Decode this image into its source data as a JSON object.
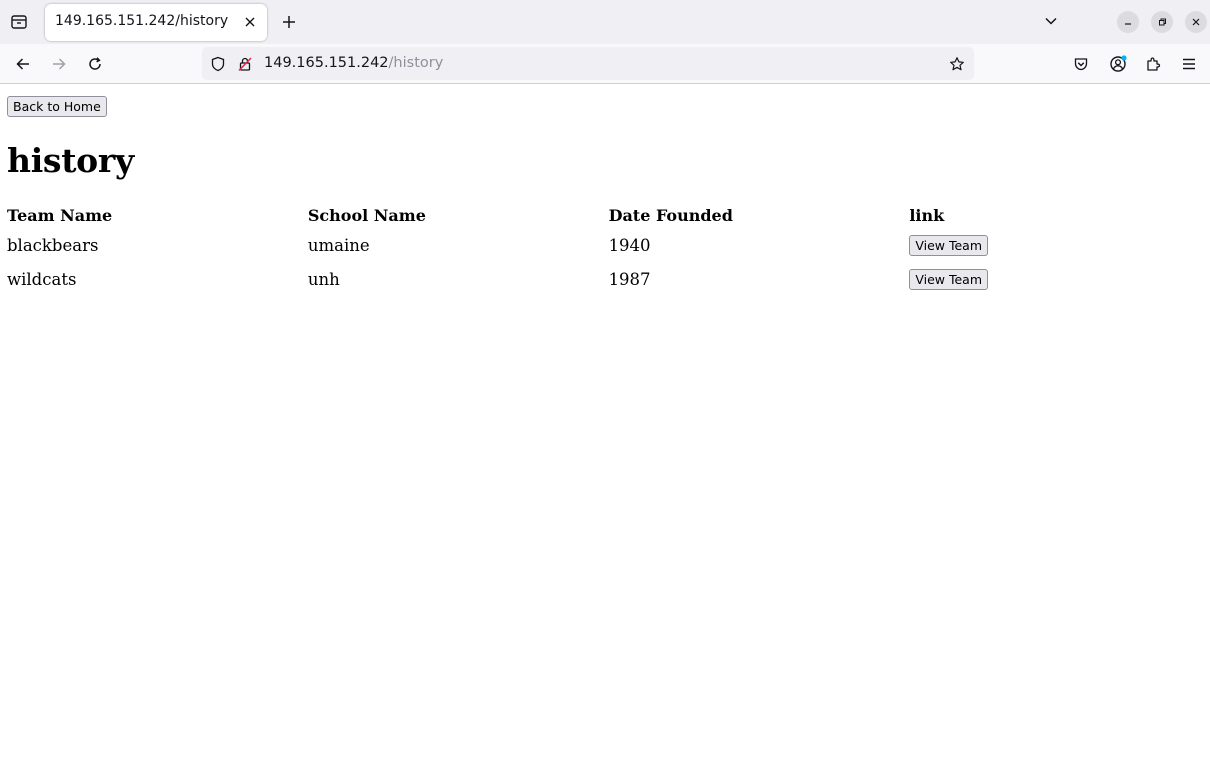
{
  "browser": {
    "tab_title": "149.165.151.242/history",
    "url_host": "149.165.151.242",
    "url_path": "/history"
  },
  "page": {
    "back_button": "Back to Home",
    "title": "history",
    "table": {
      "headers": [
        "Team Name",
        "School Name",
        "Date Founded",
        "link"
      ],
      "rows": [
        {
          "team": "blackbears",
          "school": "umaine",
          "founded": "1940",
          "action": "View Team"
        },
        {
          "team": "wildcats",
          "school": "unh",
          "founded": "1987",
          "action": "View Team"
        }
      ]
    }
  }
}
